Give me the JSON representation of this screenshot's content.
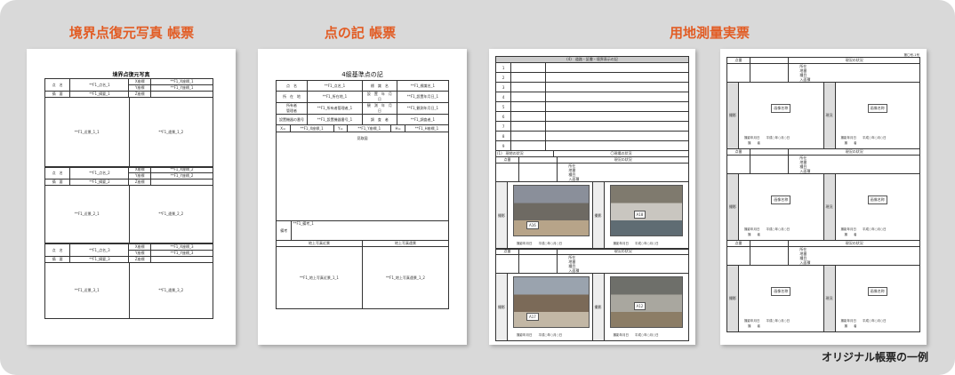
{
  "captions": [
    "境界点復元写真 帳票",
    "点の記 帳票",
    "用地測量実票"
  ],
  "footer": "オリジナル帳票の一例",
  "sheet1": {
    "title": "境界点復元写真",
    "label_name": "点　名",
    "label_remark": "摘　要",
    "blocks": [
      {
        "name": "**F1_点名_1",
        "remark": "**F1_摘要_1",
        "x": "**F1_X座標_1",
        "y": "**F1_Y座標_1",
        "photo_a": "**F1_近景_1_1",
        "photo_b": "**F1_遠景_1_2"
      },
      {
        "name": "**F1_点名_2",
        "remark": "**F1_摘要_2",
        "x": "**F1_X座標_2",
        "y": "**F1_Y座標_2",
        "photo_a": "**F1_近景_2_1",
        "photo_b": "**F1_遠景_2_2"
      },
      {
        "name": "**F1_点名_3",
        "remark": "**F1_摘要_3",
        "x": "**F1_X座標_3",
        "y": "**F1_Y座標_3",
        "photo_a": "**F1_近景_3_1",
        "photo_b": "**F1_遠景_3_2"
      }
    ],
    "coord_labels": [
      "X座標",
      "Y座標",
      "Z座標"
    ]
  },
  "sheet2": {
    "title": "4級基準点の記",
    "rows": [
      [
        "点　名",
        "**F1_点名_1",
        "標　識　名",
        "**F1_標識名_1"
      ],
      [
        "所　在　地",
        "**F1_所在地_1",
        "設　置　年　月　日",
        "**F1_設置年月日_1"
      ],
      [
        "所有者\n管理者",
        "**F1_所有者管理者_1",
        "観　測　年　月　日",
        "**F1_観測年月日_1"
      ],
      [
        "設置機器の番号",
        "**F1_設置機器番号_1",
        "調　査　者",
        "**F1_調査者_1"
      ]
    ],
    "coords": [
      "X=",
      "**F1_X座標_1",
      "Y=",
      "**F1_Y座標_1",
      "H=",
      "**F1_H座標_1"
    ],
    "sketch_label": "見取図",
    "note_value": "**F1_備考_1",
    "note_label": "備考",
    "photo_near_label": "地上写真近景",
    "photo_far_label": "地上写真遠景",
    "photo_near": "**F1_地上写真近景_1_1",
    "photo_far": "**F1_地上写真遠景_1_2"
  },
  "sheet3": {
    "header": "(4)　道路・証書・境界表示の記",
    "row_numbers": [
      "1",
      "2",
      "3",
      "4",
      "5",
      "6",
      "7",
      "8",
      "9"
    ],
    "section_label": "(1)　現地の状況",
    "section_right": "〇現場の状況",
    "col_a": "点番",
    "col_b": "現況の状況",
    "fields": [
      "所在",
      "地番",
      "種目",
      "入面積"
    ],
    "photo_labels": [
      "A16",
      "A18",
      "A17",
      "A12"
    ],
    "photo_caption": "撮影年月日　　平成○年○月○日",
    "side_a": "撮影",
    "side_b": "現況"
  },
  "sheet4": {
    "topright": "第〇号-1号",
    "col_a": "点番",
    "col_b": "現況の状況",
    "fields": [
      "所在",
      "地番",
      "種目",
      "入面積"
    ],
    "image_label": "画像名称",
    "caption": "撮影年月日　　平成○年○月○日",
    "caption2": "撮　　者",
    "side_a": "撮影",
    "side_b": "現況"
  }
}
